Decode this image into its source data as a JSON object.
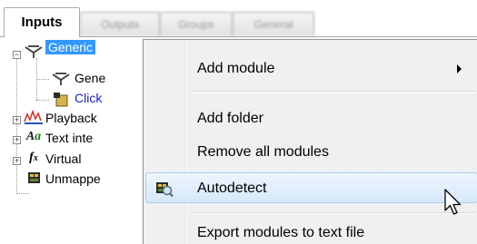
{
  "tabs": [
    {
      "label": "Inputs",
      "active": true
    },
    {
      "label": "Outputs",
      "active": false
    },
    {
      "label": "Groups",
      "active": false
    },
    {
      "label": "General",
      "active": false
    }
  ],
  "tree": {
    "items": [
      {
        "label": "Generic",
        "icon": "generic-module-icon",
        "selected": true
      },
      {
        "label": "Gene",
        "icon": "generic-module-icon"
      },
      {
        "label": "Click",
        "icon": "click-input-icon"
      },
      {
        "label": "Playback",
        "icon": "playback-icon"
      },
      {
        "label": "Text inte",
        "icon": "text-icon"
      },
      {
        "label": "Virtual",
        "icon": "function-icon"
      },
      {
        "label": "Unmappe",
        "icon": "unmapped-icon"
      }
    ]
  },
  "context_menu": {
    "items": [
      {
        "label": "Add module",
        "has_submenu": true
      },
      {
        "label": "Add folder"
      },
      {
        "label": "Remove all modules"
      },
      {
        "label": "Autodetect",
        "icon": "autodetect-icon",
        "highlighted": true
      },
      {
        "label": "Export modules to text file"
      }
    ]
  },
  "colors": {
    "selection": "#3399ff",
    "menu_hover": "#d6e8fb",
    "menu_bg": "#f0f0f0"
  }
}
